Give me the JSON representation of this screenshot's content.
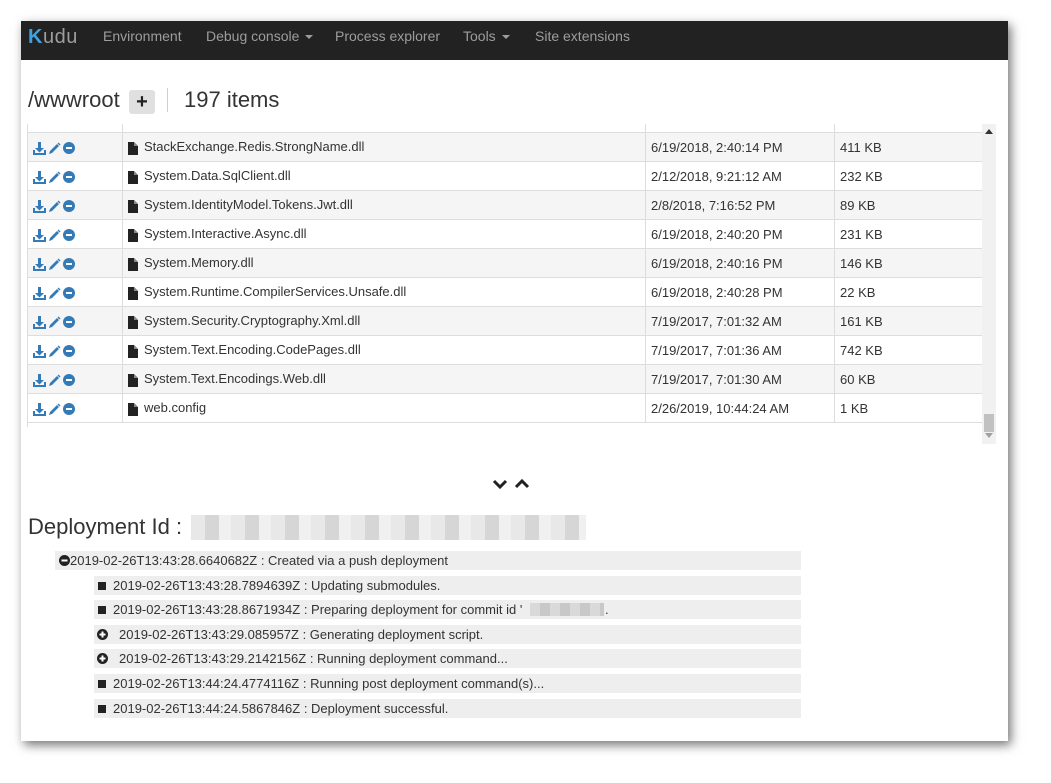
{
  "navbar": {
    "brand": "Kudu",
    "items": [
      {
        "label": "Environment",
        "dropdown": false
      },
      {
        "label": "Debug console",
        "dropdown": true
      },
      {
        "label": "Process explorer",
        "dropdown": false
      },
      {
        "label": "Tools",
        "dropdown": true
      },
      {
        "label": "Site extensions",
        "dropdown": false
      }
    ]
  },
  "header": {
    "path": "/wwwroot",
    "add_label": "+",
    "items_count": "197 items"
  },
  "files": [
    {
      "name": "StackExchange.Redis.StrongName.dll",
      "modified": "6/19/2018, 2:40:14 PM",
      "size": "411 KB"
    },
    {
      "name": "System.Data.SqlClient.dll",
      "modified": "2/12/2018, 9:21:12 AM",
      "size": "232 KB"
    },
    {
      "name": "System.IdentityModel.Tokens.Jwt.dll",
      "modified": "2/8/2018, 7:16:52 PM",
      "size": "89 KB"
    },
    {
      "name": "System.Interactive.Async.dll",
      "modified": "6/19/2018, 2:40:20 PM",
      "size": "231 KB"
    },
    {
      "name": "System.Memory.dll",
      "modified": "6/19/2018, 2:40:16 PM",
      "size": "146 KB"
    },
    {
      "name": "System.Runtime.CompilerServices.Unsafe.dll",
      "modified": "6/19/2018, 2:40:28 PM",
      "size": "22 KB"
    },
    {
      "name": "System.Security.Cryptography.Xml.dll",
      "modified": "7/19/2017, 7:01:32 AM",
      "size": "161 KB"
    },
    {
      "name": "System.Text.Encoding.CodePages.dll",
      "modified": "7/19/2017, 7:01:36 AM",
      "size": "742 KB"
    },
    {
      "name": "System.Text.Encodings.Web.dll",
      "modified": "7/19/2017, 7:01:30 AM",
      "size": "60 KB"
    },
    {
      "name": "web.config",
      "modified": "2/26/2019, 10:44:24 AM",
      "size": "1 KB"
    }
  ],
  "deployment": {
    "title": "Deployment Id :",
    "log": [
      {
        "text": "2019-02-26T13:43:28.6640682Z : Created via a push deployment",
        "icon": "minus-circle-icon",
        "level": 0
      },
      {
        "text": "2019-02-26T13:43:28.7894639Z : Updating submodules.",
        "icon": "square-bullet-icon",
        "level": 1
      },
      {
        "text": "2019-02-26T13:43:28.8671934Z : Preparing deployment for commit id '",
        "text_after": ".",
        "icon": "square-bullet-icon",
        "level": 1
      },
      {
        "text": "2019-02-26T13:43:29.085957Z : Generating deployment script.",
        "icon": "plus-circle-icon",
        "level": 1
      },
      {
        "text": "2019-02-26T13:43:29.2142156Z : Running deployment command...",
        "icon": "plus-circle-icon",
        "level": 1
      },
      {
        "text": "2019-02-26T13:44:24.4774116Z : Running post deployment command(s)...",
        "icon": "square-bullet-icon",
        "level": 1
      },
      {
        "text": "2019-02-26T13:44:24.5867846Z : Deployment successful.",
        "icon": "square-bullet-icon",
        "level": 1
      }
    ]
  },
  "colors": {
    "navbar_bg": "#222222",
    "nav_text": "#9d9d9d",
    "action_blue": "#337ab7",
    "row_alt": "#f5f5f5",
    "log_bg": "#eeeeee"
  }
}
